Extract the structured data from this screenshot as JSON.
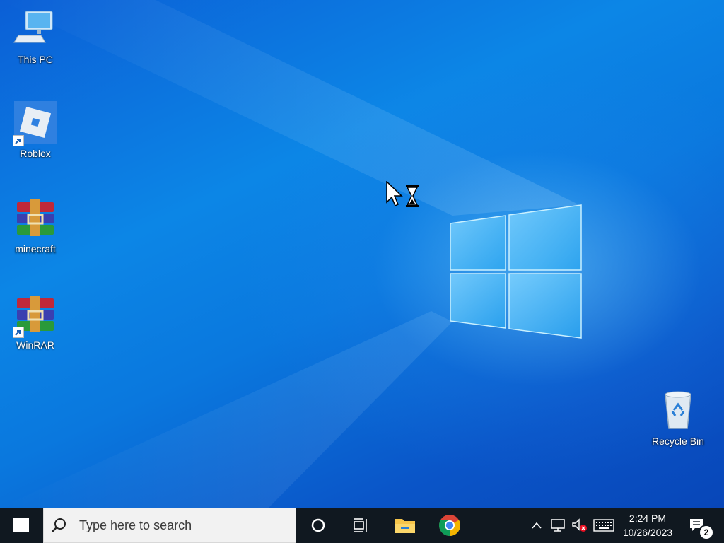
{
  "desktop": {
    "icons": [
      {
        "label": "This PC",
        "icon": "computer-icon"
      },
      {
        "label": "Roblox",
        "icon": "roblox-icon",
        "shortcut": true
      },
      {
        "label": "minecraft",
        "icon": "winrar-archive-icon"
      },
      {
        "label": "WinRAR",
        "icon": "winrar-icon",
        "shortcut": true
      },
      {
        "label": "Recycle Bin",
        "icon": "recycle-bin-icon"
      }
    ]
  },
  "cursor": {
    "state": "busy",
    "icon": "arrow-hourglass-cursor"
  },
  "taskbar": {
    "start_icon": "windows-start-icon",
    "search": {
      "placeholder": "Type here to search",
      "icon": "search-icon"
    },
    "cortana_icon": "cortana-icon",
    "task_view_icon": "task-view-icon",
    "pinned": [
      {
        "name": "File Explorer",
        "icon": "file-explorer-icon"
      },
      {
        "name": "Google Chrome",
        "icon": "chrome-icon"
      }
    ],
    "tray": {
      "chevron_icon": "chevron-up-icon",
      "network_icon": "network-icon",
      "volume_icon": "volume-muted-icon",
      "keyboard_icon": "touch-keyboard-icon",
      "time": "2:24 PM",
      "date": "10/26/2023",
      "notifications_icon": "notifications-icon",
      "notification_count": "2"
    }
  },
  "colors": {
    "taskbar_bg": "#101820",
    "desktop_accent": "#0a78de"
  }
}
